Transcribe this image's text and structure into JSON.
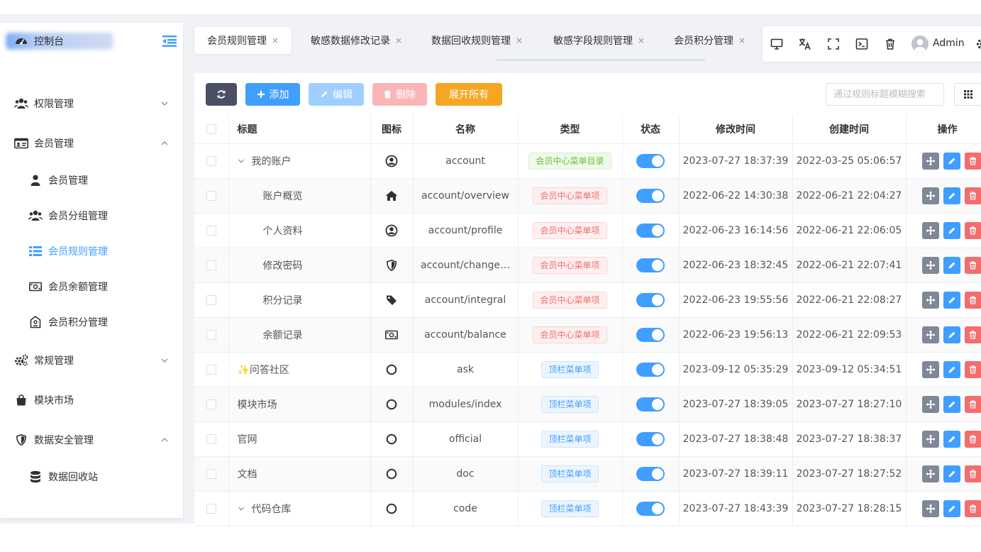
{
  "tabs": [
    {
      "label": "会员规则管理",
      "active": true
    },
    {
      "label": "敏感数据修改记录",
      "active": false
    },
    {
      "label": "数据回收规则管理",
      "active": false
    },
    {
      "label": "敏感字段规则管理",
      "active": false
    },
    {
      "label": "会员积分管理",
      "active": false
    }
  ],
  "tab_close_glyph": "×",
  "header": {
    "username": "Admin",
    "icons": [
      "monitor-icon",
      "translate-icon",
      "fullscreen-icon",
      "terminal-icon",
      "trash-icon",
      "avatar",
      "settings-icon"
    ]
  },
  "sidebar": {
    "items": [
      {
        "label": "控制台",
        "icon": "dashboard-icon",
        "level": 0
      },
      {
        "label": "权限管理",
        "icon": "users-icon",
        "level": 0,
        "chevron": "down"
      },
      {
        "label": "会员管理",
        "icon": "id-card-icon",
        "level": 0,
        "chevron": "up"
      },
      {
        "label": "会员管理",
        "icon": "user-icon",
        "level": 1
      },
      {
        "label": "会员分组管理",
        "icon": "users-icon",
        "level": 1
      },
      {
        "label": "会员规则管理",
        "icon": "list-icon",
        "level": 1,
        "active": true
      },
      {
        "label": "会员余额管理",
        "icon": "money-icon",
        "level": 1
      },
      {
        "label": "会员积分管理",
        "icon": "points-icon",
        "level": 1
      },
      {
        "label": "常规管理",
        "icon": "cogs-icon",
        "level": 0,
        "chevron": "down"
      },
      {
        "label": "模块市场",
        "icon": "shopping-bag-icon",
        "level": 0
      },
      {
        "label": "数据安全管理",
        "icon": "shield-icon",
        "level": 0,
        "chevron": "up"
      },
      {
        "label": "数据回收站",
        "icon": "database-icon",
        "level": 1
      }
    ]
  },
  "toolbar": {
    "add_label": "添加",
    "edit_label": "编辑",
    "delete_label": "删除",
    "expand_label": "展开所有",
    "search_placeholder": "通过规则标题模糊搜索"
  },
  "table": {
    "columns": [
      "标题",
      "图标",
      "名称",
      "类型",
      "状态",
      "修改时间",
      "创建时间",
      "操作"
    ],
    "rows": [
      {
        "title": "我的账户",
        "indent": 0,
        "expand": true,
        "icon": "user-circle-icon",
        "name": "account",
        "type": "会员中心菜单目录",
        "type_color": "green",
        "status": true,
        "updated": "2023-07-27 18:37:39",
        "created": "2022-03-25 05:06:57"
      },
      {
        "title": "账户概览",
        "indent": 1,
        "expand": false,
        "icon": "home-icon",
        "name": "account/overview",
        "type": "会员中心菜单项",
        "type_color": "red",
        "status": true,
        "updated": "2022-06-22 14:30:38",
        "created": "2022-06-21 22:04:27"
      },
      {
        "title": "个人资料",
        "indent": 1,
        "expand": false,
        "icon": "user-circle-icon",
        "name": "account/profile",
        "type": "会员中心菜单项",
        "type_color": "red",
        "status": true,
        "updated": "2022-06-23 16:14:56",
        "created": "2022-06-21 22:06:05"
      },
      {
        "title": "修改密码",
        "indent": 1,
        "expand": false,
        "icon": "shield-icon",
        "name": "account/change…",
        "type": "会员中心菜单项",
        "type_color": "red",
        "status": true,
        "updated": "2022-06-23 18:32:45",
        "created": "2022-06-21 22:07:41"
      },
      {
        "title": "积分记录",
        "indent": 1,
        "expand": false,
        "icon": "tag-icon",
        "name": "account/integral",
        "type": "会员中心菜单项",
        "type_color": "red",
        "status": true,
        "updated": "2022-06-23 19:55:56",
        "created": "2022-06-21 22:08:27"
      },
      {
        "title": "余额记录",
        "indent": 1,
        "expand": false,
        "icon": "money-icon",
        "name": "account/balance",
        "type": "会员中心菜单项",
        "type_color": "red",
        "status": true,
        "updated": "2022-06-23 19:56:13",
        "created": "2022-06-21 22:09:53"
      },
      {
        "title": "✨问答社区",
        "indent": 0,
        "expand": false,
        "icon": "circle-icon",
        "name": "ask",
        "type": "顶栏菜单项",
        "type_color": "blue",
        "status": true,
        "updated": "2023-09-12 05:35:29",
        "created": "2023-09-12 05:34:51"
      },
      {
        "title": "模块市场",
        "indent": 0,
        "expand": false,
        "icon": "circle-icon",
        "name": "modules/index",
        "type": "顶栏菜单项",
        "type_color": "blue",
        "status": true,
        "updated": "2023-07-27 18:39:05",
        "created": "2023-07-27 18:27:10"
      },
      {
        "title": "官网",
        "indent": 0,
        "expand": false,
        "icon": "circle-icon",
        "name": "official",
        "type": "顶栏菜单项",
        "type_color": "blue",
        "status": true,
        "updated": "2023-07-27 18:38:48",
        "created": "2023-07-27 18:38:37"
      },
      {
        "title": "文档",
        "indent": 0,
        "expand": false,
        "icon": "circle-icon",
        "name": "doc",
        "type": "顶栏菜单项",
        "type_color": "blue",
        "status": true,
        "updated": "2023-07-27 18:39:11",
        "created": "2023-07-27 18:27:52"
      },
      {
        "title": "代码仓库",
        "indent": 0,
        "expand": true,
        "icon": "circle-icon",
        "name": "code",
        "type": "顶栏菜单项",
        "type_color": "blue",
        "status": true,
        "updated": "2023-07-27 18:43:39",
        "created": "2023-07-27 18:28:15"
      }
    ]
  },
  "colors": {
    "primary": "#409eff",
    "success": "#67c23a",
    "danger": "#f56c6c",
    "warning": "#f5a623",
    "dark": "#4a5064"
  }
}
